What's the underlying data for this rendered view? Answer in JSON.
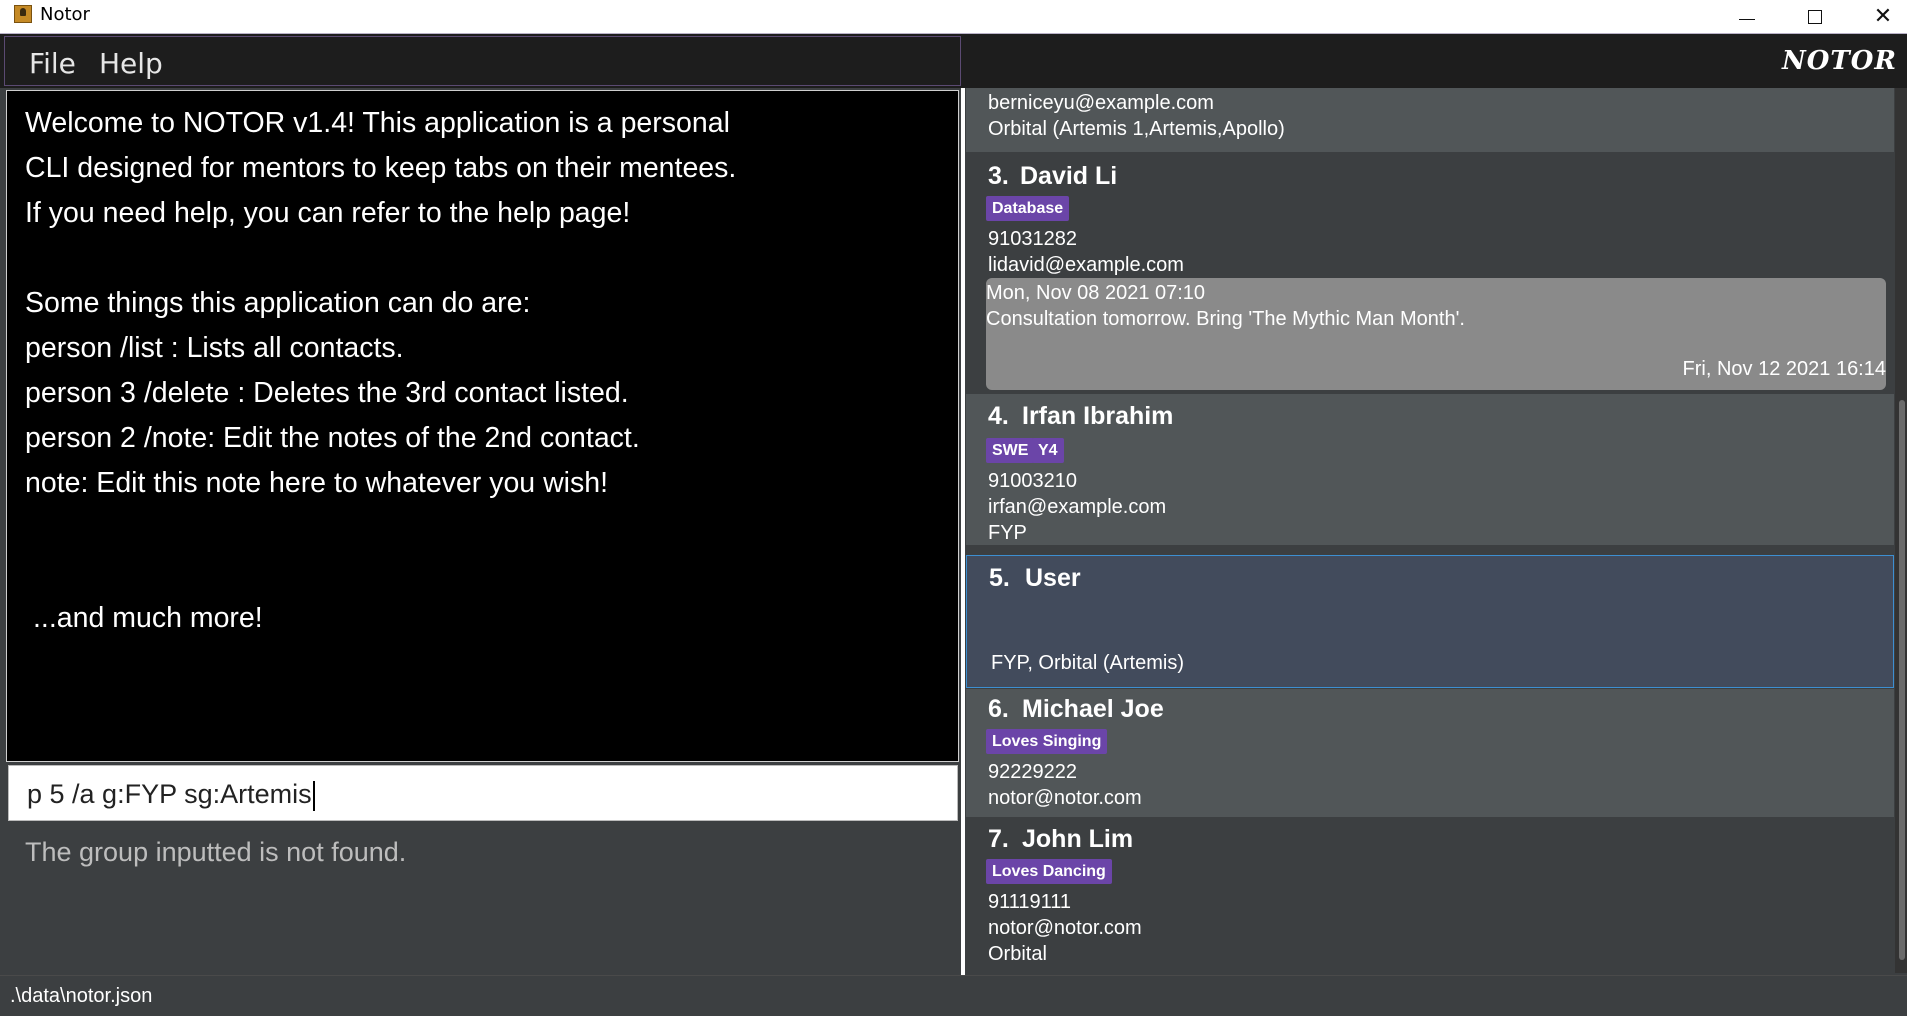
{
  "window": {
    "title": "Notor"
  },
  "menu": {
    "file": "File",
    "help": "Help"
  },
  "brand": "NOTOR",
  "welcome": {
    "lines": [
      "Welcome to NOTOR v1.4! This application is a personal",
      "CLI designed for mentors to keep tabs on their mentees.",
      "If you need help, you can refer to the help page!",
      "",
      "Some things this application can do are:",
      "person /list : Lists all contacts.",
      "person 3 /delete : Deletes the 3rd contact listed.",
      "person 2 /note: Edit the notes of the 2nd contact.",
      "note: Edit this note here to whatever you wish!"
    ],
    "more": "...and much more!"
  },
  "command": {
    "value": "p 5 /a g:FYP sg:Artemis"
  },
  "result": {
    "message": "The group inputted is not found."
  },
  "people": {
    "partial": {
      "email": "berniceyu@example.com",
      "groups": "Orbital (Artemis 1,Artemis,Apollo)"
    },
    "p3": {
      "index": "3.",
      "name": "David Li",
      "tags": [
        "Database"
      ],
      "phone": "91031282",
      "email": "lidavid@example.com",
      "note_date": "Mon, Nov 08 2021 07:10",
      "note": "Consultation tomorrow. Bring 'The Mythic Man Month'.",
      "note_edited": "Fri, Nov 12 2021 16:14"
    },
    "p4": {
      "index": "4.",
      "name": "Irfan Ibrahim",
      "tags": [
        "SWE",
        "Y4"
      ],
      "phone": "91003210",
      "email": "irfan@example.com",
      "groups": "FYP"
    },
    "p5": {
      "index": "5.",
      "name": "User",
      "groups": "FYP, Orbital (Artemis)"
    },
    "p6": {
      "index": "6.",
      "name": "Michael Joe",
      "tags": [
        "Loves Singing"
      ],
      "phone": "92229222",
      "email": "notor@notor.com"
    },
    "p7": {
      "index": "7.",
      "name": "John Lim",
      "tags": [
        "Loves Dancing"
      ],
      "phone": "91119111",
      "email": "notor@notor.com",
      "groups": "Orbital"
    }
  },
  "status": {
    "path": ".\\data\\notor.json"
  },
  "colors": {
    "tag": "#6b45a8",
    "selected_border": "#3d8fd1",
    "card_light": "#515658",
    "card_dark": "#3c3f41"
  }
}
